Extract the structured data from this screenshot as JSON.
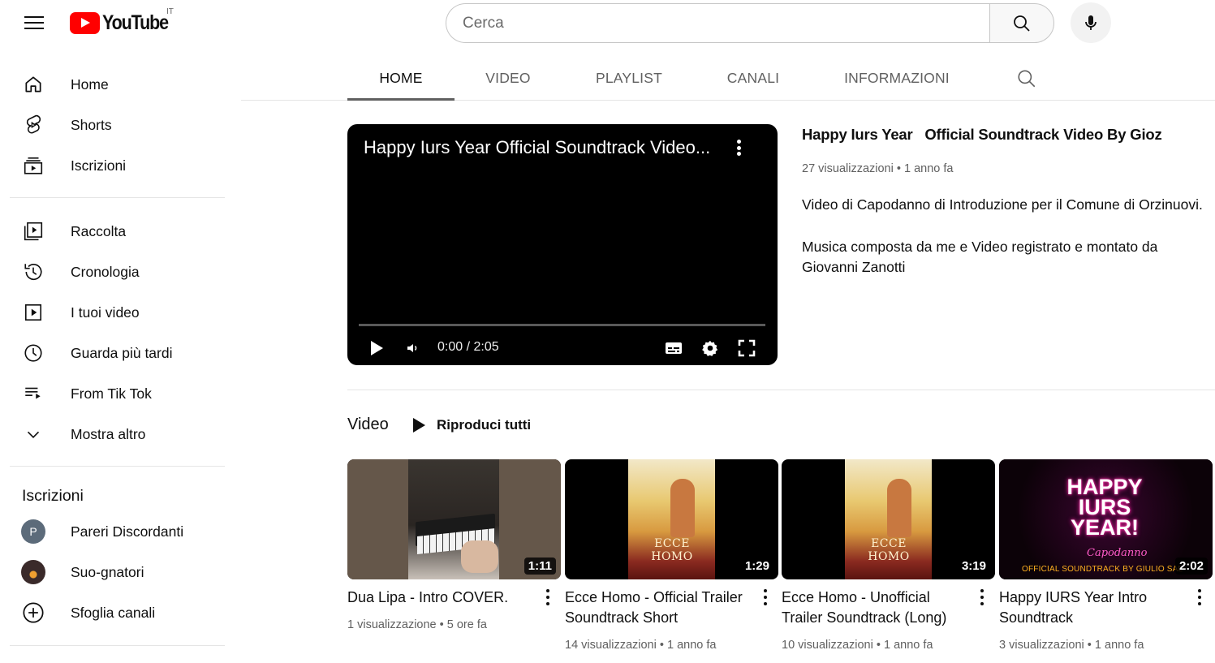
{
  "masthead": {
    "logo_text": "YouTube",
    "country_code": "IT",
    "search_placeholder": "Cerca"
  },
  "sidebar": {
    "items": [
      {
        "label": "Home",
        "icon": "home-icon"
      },
      {
        "label": "Shorts",
        "icon": "shorts-icon"
      },
      {
        "label": "Iscrizioni",
        "icon": "subscriptions-icon"
      },
      {
        "label": "Raccolta",
        "icon": "library-icon"
      },
      {
        "label": "Cronologia",
        "icon": "history-icon"
      },
      {
        "label": "I tuoi video",
        "icon": "your-videos-icon"
      },
      {
        "label": "Guarda più tardi",
        "icon": "watch-later-icon"
      },
      {
        "label": "From Tik Tok",
        "icon": "playlist-icon"
      },
      {
        "label": "Mostra altro",
        "icon": "chevron-down-icon"
      }
    ],
    "subscriptions_heading": "Iscrizioni",
    "subscriptions": [
      {
        "label": "Pareri Discordanti",
        "avatar_letter": "P",
        "avatar_color": "#5c6b7a"
      },
      {
        "label": "Suo-gnatori",
        "avatar_letter": "",
        "avatar_color": "#3a2a2a"
      },
      {
        "label": "Sfoglia canali",
        "icon": "add-circle-icon"
      }
    ]
  },
  "tabs": [
    {
      "label": "HOME",
      "active": true
    },
    {
      "label": "VIDEO",
      "active": false
    },
    {
      "label": "PLAYLIST",
      "active": false
    },
    {
      "label": "CANALI",
      "active": false
    },
    {
      "label": "INFORMAZIONI",
      "active": false
    }
  ],
  "featured": {
    "player_title": "Happy Iurs Year Official Soundtrack Video...",
    "time": "0:00 / 2:05",
    "title": "Happy Iurs Year   Official Soundtrack Video By Gioz",
    "views": "27 visualizzazioni",
    "age": "1 anno fa",
    "description_1": "Video di Capodanno di Introduzione per il Comune di Orzinuovi.",
    "description_2": "Musica composta da me e Video registrato e montato da Giovanni Zanotti"
  },
  "shelf": {
    "title": "Video",
    "play_all_label": "Riproduci tutti",
    "videos": [
      {
        "title": "Dua Lipa - Intro COVER.",
        "duration": "1:11",
        "views": "1 visualizzazione",
        "age": "5 ore fa"
      },
      {
        "title": "Ecce Homo - Official Trailer Soundtrack Short",
        "duration": "1:29",
        "views": "14 visualizzazioni",
        "age": "1 anno fa",
        "poster_text": "ECCE HOMO"
      },
      {
        "title": "Ecce Homo - Unofficial Trailer Soundtrack (Long)",
        "duration": "3:19",
        "views": "10 visualizzazioni",
        "age": "1 anno fa",
        "poster_text": "ECCE HOMO"
      },
      {
        "title": "Happy IURS Year Intro Soundtrack",
        "duration": "2:02",
        "views": "3 visualizzazioni",
        "age": "1 anno fa",
        "thumb_text": "HAPPY IURS YEAR!",
        "thumb_script": "Capodanno",
        "thumb_footer": "OFFICIAL SOUNDTRACK BY GIULIO SAL"
      }
    ]
  },
  "colors": {
    "brand_red": "#ff0000",
    "text_primary": "#0f0f0f",
    "text_secondary": "#606060"
  }
}
